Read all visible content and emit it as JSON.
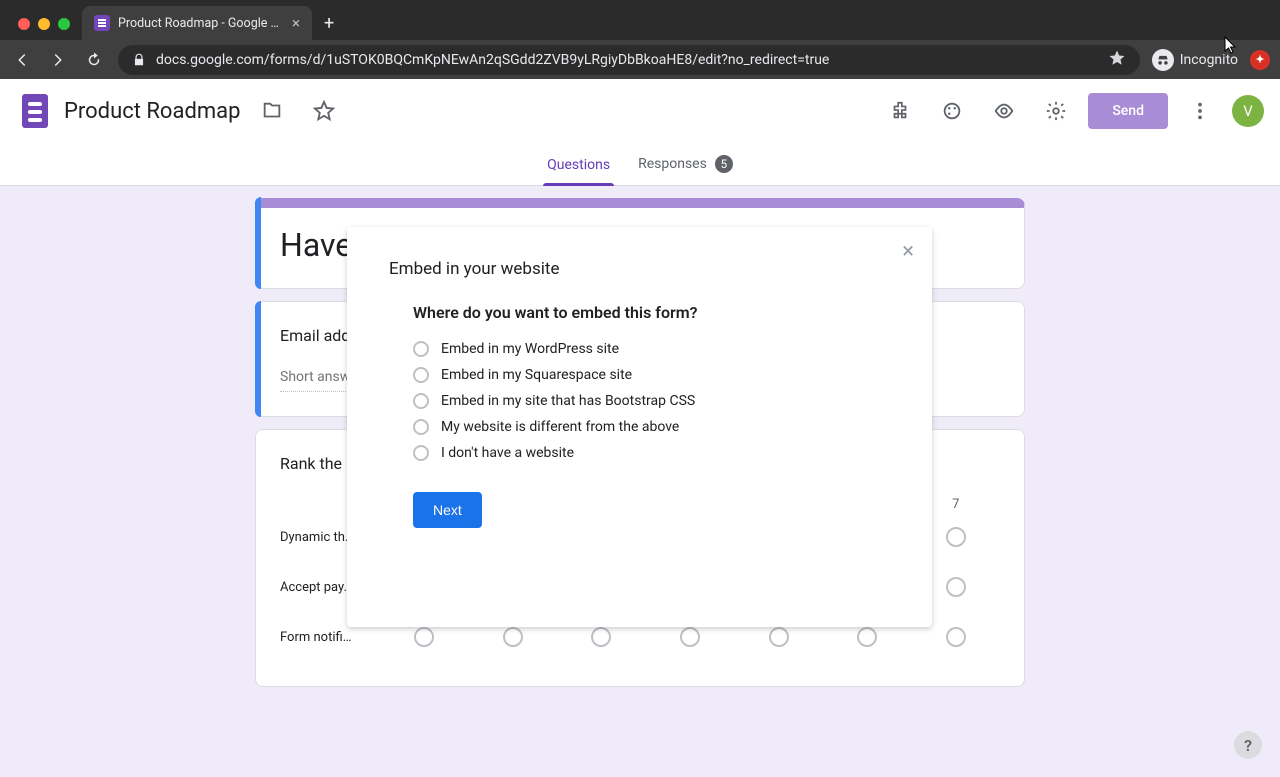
{
  "browser": {
    "tab_title": "Product Roadmap - Google Form",
    "url": "docs.google.com/forms/d/1uSTOK0BQCmKpNEwAn2qSGdd2ZVB9yLRgiyDbBkoaHE8/edit?no_redirect=true",
    "incognito_label": "Incognito",
    "traffic_light_colors": {
      "close": "#ff5f57",
      "min": "#febc2e",
      "max": "#28c840"
    }
  },
  "header": {
    "doc_title": "Product Roadmap",
    "send_label": "Send",
    "avatar_letter": "V",
    "accent": "#673ab7"
  },
  "tabs": {
    "questions": "Questions",
    "responses": "Responses",
    "response_count": "5"
  },
  "form": {
    "title_visible": "Have",
    "email_q": "Email add",
    "short_answer_placeholder": "Short answ",
    "rank_q": "Rank the",
    "grid_col_visible": "7",
    "grid_rows": [
      "Dynamic th…",
      "Accept pay…",
      "Form notifi…"
    ]
  },
  "modal": {
    "title": "Embed in your website",
    "subtitle": "Where do you want to embed this form?",
    "options": [
      "Embed in my WordPress site",
      "Embed in my Squarespace site",
      "Embed in my site that has Bootstrap CSS",
      "My website is different from the above",
      "I don't have a website"
    ],
    "next_label": "Next",
    "close_glyph": "×"
  },
  "help_glyph": "?"
}
